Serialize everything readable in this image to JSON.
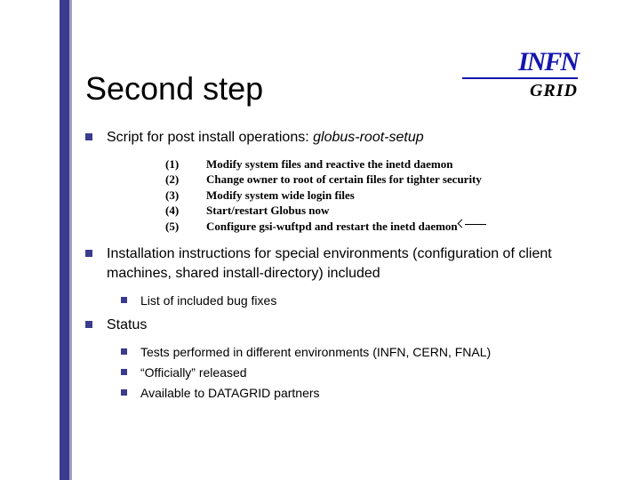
{
  "logo": {
    "brand": "INFN",
    "sub": "GRID"
  },
  "title": "Second step",
  "bullet1": {
    "prefix": "Script for post install operations: ",
    "em": "globus-root-setup"
  },
  "steps": [
    {
      "n": "(1)",
      "t": "Modify system files and reactive the inetd daemon"
    },
    {
      "n": "(2)",
      "t": "Change owner to root of certain files for tighter security"
    },
    {
      "n": "(3)",
      "t": " Modify system wide login files"
    },
    {
      "n": "(4)",
      "t": "Start/restart Globus now"
    },
    {
      "n": "(5)",
      "t": "Configure gsi-wuftpd and restart the inetd daemon"
    }
  ],
  "bullet2": "Installation instructions for special environments (configuration of client machines, shared install-directory) included",
  "bullet2_sub": "List of included bug fixes",
  "bullet3": "Status",
  "bullet3_subs": [
    "Tests performed in different environments (INFN, CERN, FNAL)",
    "“Officially” released",
    "Available to DATAGRID partners"
  ]
}
